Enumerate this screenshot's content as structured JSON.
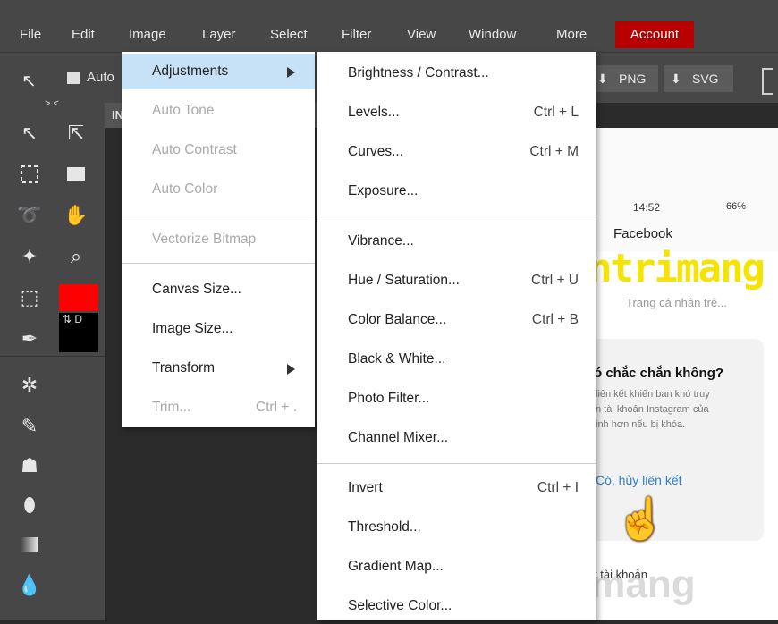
{
  "menubar": {
    "items": [
      "File",
      "Edit",
      "Image",
      "Layer",
      "Select",
      "Filter",
      "View",
      "Window",
      "More"
    ],
    "account": "Account",
    "accent": "#b80000"
  },
  "toolbar": {
    "auto_label": "Auto",
    "png_label": "PNG",
    "svg_label": "SVG"
  },
  "tools": {
    "collapse": ">  <",
    "swap_label": "⇅ D"
  },
  "doc_tab": {
    "label": "IN"
  },
  "image_menu": {
    "items": [
      {
        "label": "Adjustments",
        "has_submenu": true,
        "state": "highlighted"
      },
      {
        "label": "Auto Tone",
        "state": "disabled"
      },
      {
        "label": "Auto Contrast",
        "state": "disabled"
      },
      {
        "label": "Auto Color",
        "state": "disabled"
      },
      {
        "label": "Vectorize Bitmap",
        "state": "disabled"
      },
      {
        "label": "Canvas Size...",
        "state": "enabled"
      },
      {
        "label": "Image Size...",
        "state": "enabled"
      },
      {
        "label": "Transform",
        "has_submenu": true,
        "state": "enabled"
      },
      {
        "label": "Trim...",
        "shortcut": "Ctrl + .",
        "state": "disabled"
      }
    ]
  },
  "adjustments_menu": {
    "items": [
      {
        "label": "Brightness / Contrast...",
        "shortcut": ""
      },
      {
        "label": "Levels...",
        "shortcut": "Ctrl + L"
      },
      {
        "label": "Curves...",
        "shortcut": "Ctrl + M"
      },
      {
        "label": "Exposure...",
        "shortcut": ""
      },
      {
        "label": "Vibrance...",
        "shortcut": ""
      },
      {
        "label": "Hue / Saturation...",
        "shortcut": "Ctrl + U"
      },
      {
        "label": "Color Balance...",
        "shortcut": "Ctrl + B"
      },
      {
        "label": "Black & White...",
        "shortcut": ""
      },
      {
        "label": "Photo Filter...",
        "shortcut": ""
      },
      {
        "label": "Channel Mixer...",
        "shortcut": ""
      },
      {
        "label": "Invert",
        "shortcut": "Ctrl + I"
      },
      {
        "label": "Threshold...",
        "shortcut": ""
      },
      {
        "label": "Gradient Map...",
        "shortcut": ""
      },
      {
        "label": "Selective Color...",
        "shortcut": ""
      }
    ]
  },
  "canvas": {
    "time": "14:52",
    "battery": "66%",
    "app_title": "Facebook",
    "brand_text": "ntrimang",
    "subtitle": "Trang cá nhân trê...",
    "dialog_title": "ó chắc chắn không?",
    "dialog_body_1": "liên kết khiến bạn khó truy",
    "dialog_body_2": "n tài khoản Instagram của",
    "dialog_body_3": "inh hơn nếu bị khóa.",
    "dialog_confirm": "Có, hủy liên kết",
    "footer_text": "t tài khoản",
    "watermark": "uantrimang"
  },
  "colors": {
    "foreground": "#ff0000",
    "background": "#000000",
    "highlight": "#c7e2f6",
    "link": "#2f7fd6"
  }
}
